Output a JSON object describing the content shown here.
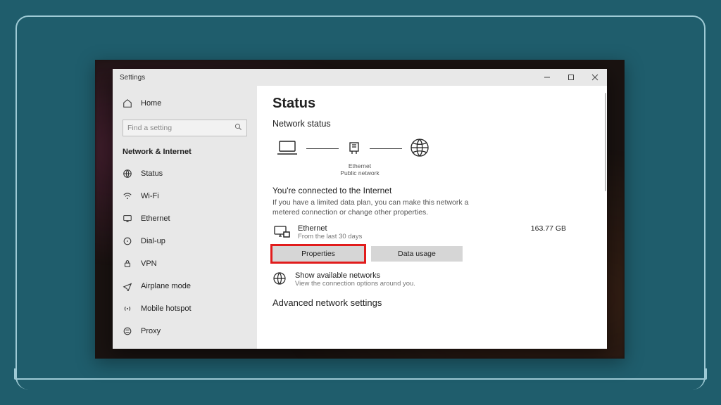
{
  "window": {
    "title": "Settings"
  },
  "sidebar": {
    "home": "Home",
    "search_placeholder": "Find a setting",
    "section": "Network & Internet",
    "items": [
      "Status",
      "Wi-Fi",
      "Ethernet",
      "Dial-up",
      "VPN",
      "Airplane mode",
      "Mobile hotspot",
      "Proxy"
    ]
  },
  "main": {
    "heading": "Status",
    "subheading": "Network status",
    "diag_label1": "Ethernet",
    "diag_label2": "Public network",
    "connected_title": "You're connected to the Internet",
    "connected_sub": "If you have a limited data plan, you can make this network a metered connection or change other properties.",
    "conn_name": "Ethernet",
    "conn_sub": "From the last 30 days",
    "conn_usage": "163.77 GB",
    "btn_properties": "Properties",
    "btn_datausage": "Data usage",
    "available_title": "Show available networks",
    "available_sub": "View the connection options around you.",
    "advanced": "Advanced network settings"
  }
}
